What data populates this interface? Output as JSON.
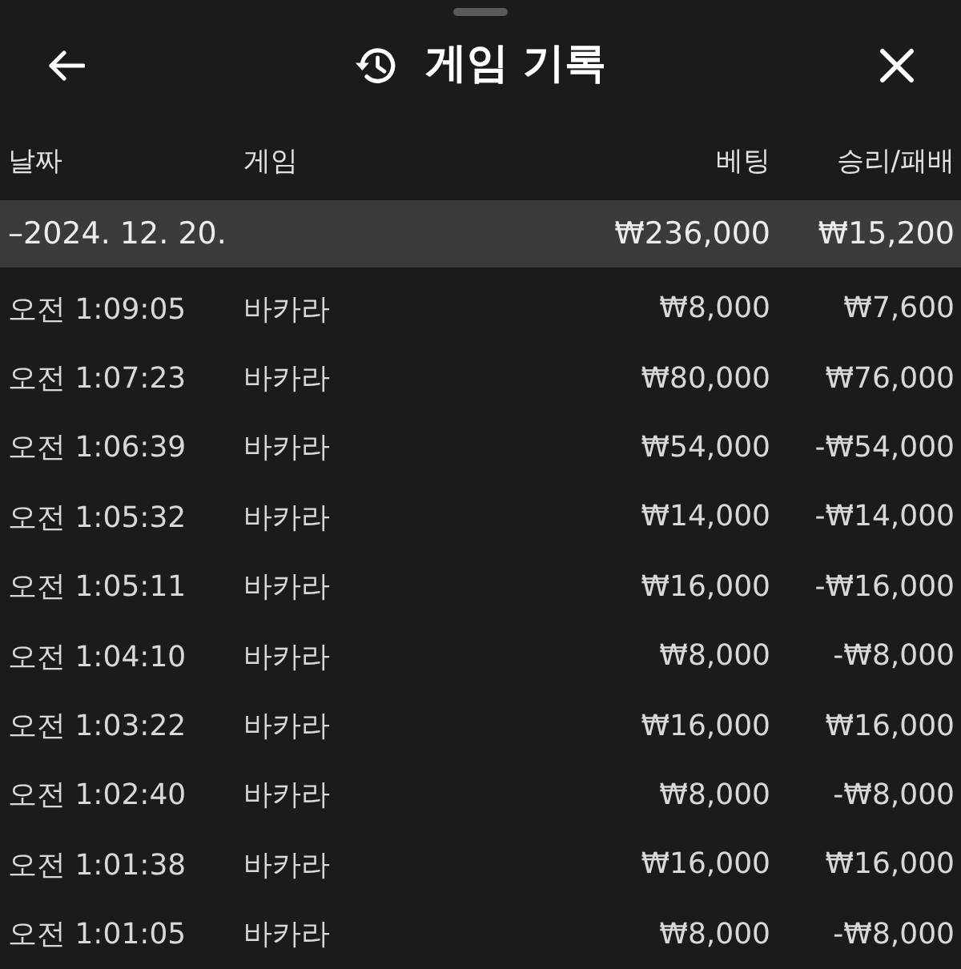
{
  "window": {
    "title": "게임 기록"
  },
  "table": {
    "columns": [
      "날짜",
      "게임",
      "베팅",
      "승리/패배"
    ],
    "groups": [
      {
        "label": "–2024. 12. 20.",
        "bet": "₩236,000",
        "result": "₩15,200",
        "rows": [
          {
            "time": "오전 1:09:05",
            "game": "바카라",
            "bet": "₩8,000",
            "result": "₩7,600"
          },
          {
            "time": "오전 1:07:23",
            "game": "바카라",
            "bet": "₩80,000",
            "result": "₩76,000"
          },
          {
            "time": "오전 1:06:39",
            "game": "바카라",
            "bet": "₩54,000",
            "result": "-₩54,000"
          },
          {
            "time": "오전 1:05:32",
            "game": "바카라",
            "bet": "₩14,000",
            "result": "-₩14,000"
          },
          {
            "time": "오전 1:05:11",
            "game": "바카라",
            "bet": "₩16,000",
            "result": "-₩16,000"
          },
          {
            "time": "오전 1:04:10",
            "game": "바카라",
            "bet": "₩8,000",
            "result": "-₩8,000"
          },
          {
            "time": "오전 1:03:22",
            "game": "바카라",
            "bet": "₩16,000",
            "result": "₩16,000"
          },
          {
            "time": "오전 1:02:40",
            "game": "바카라",
            "bet": "₩8,000",
            "result": "-₩8,000"
          },
          {
            "time": "오전 1:01:38",
            "game": "바카라",
            "bet": "₩16,000",
            "result": "₩16,000"
          },
          {
            "time": "오전 1:01:05",
            "game": "바카라",
            "bet": "₩8,000",
            "result": "-₩8,000"
          }
        ]
      }
    ]
  }
}
